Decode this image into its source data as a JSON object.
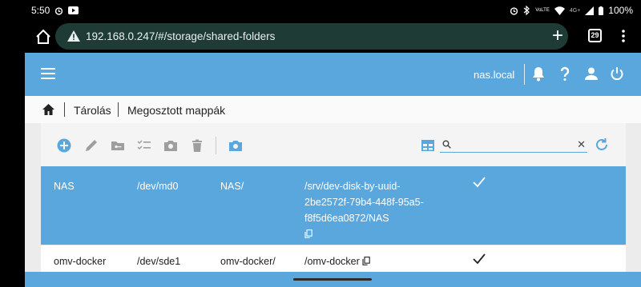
{
  "status_bar": {
    "time": "5:50",
    "battery": "100%",
    "network": "4G+"
  },
  "browser": {
    "url": "192.168.0.247/#/storage/shared-folders",
    "tab_count": "29"
  },
  "header": {
    "hostname": "nas.local"
  },
  "breadcrumb": {
    "items": [
      "Tárolás",
      "Megosztott mappák"
    ]
  },
  "toolbar": {
    "icons": [
      "add-icon",
      "edit-icon",
      "folder-key-icon",
      "list-check-icon",
      "camera-icon",
      "delete-icon",
      "snapshot-icon",
      "table-view-icon",
      "refresh-icon"
    ],
    "search_value": ""
  },
  "table": {
    "rows": [
      {
        "name": "NAS",
        "device": "/dev/md0",
        "relpath": "NAS/",
        "path_lines": [
          "/srv/dev-disk-by-uuid-",
          "2be2572f-79b4-448f-95a5-",
          "f8f5d6ea0872/NAS"
        ],
        "selected": true,
        "checked": true
      },
      {
        "name": "omv-docker",
        "device": "/dev/sde1",
        "relpath": "omv-docker/",
        "path_lines": [
          "/omv-docker"
        ],
        "selected": false,
        "checked": true
      }
    ]
  },
  "colors": {
    "accent": "#5aa7dd",
    "url_bar": "#1f3b36",
    "toolbar_icon": "#9e9e9e"
  }
}
